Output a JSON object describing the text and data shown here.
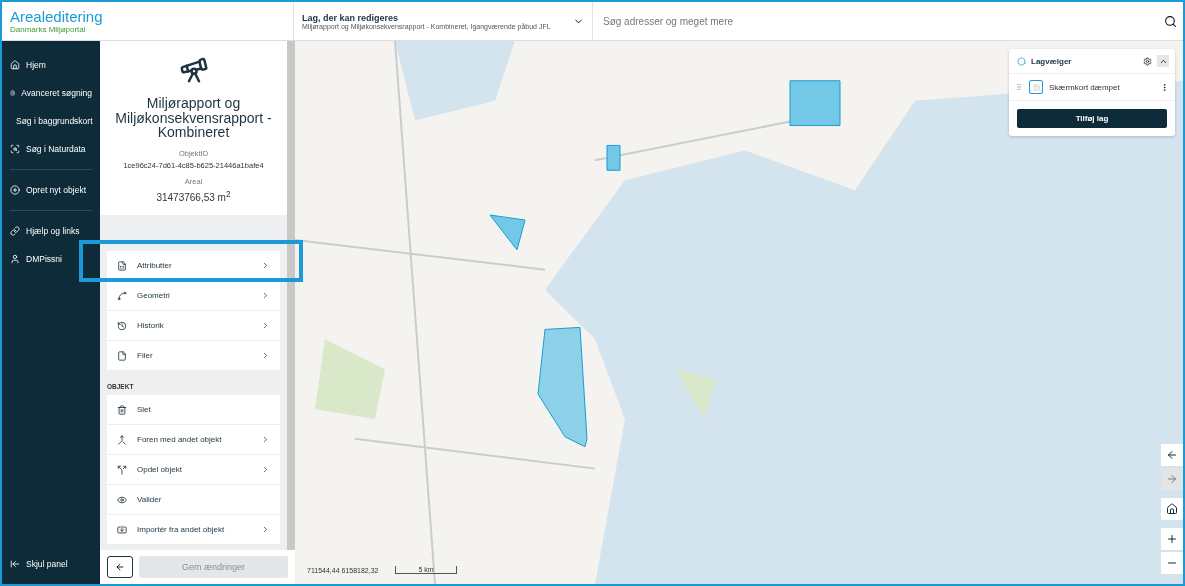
{
  "header": {
    "app_title": "Arealeditering",
    "app_subtitle": "Danmarks Miljøportal",
    "layer_select": {
      "label": "Lag, der kan redigeres",
      "value": "Miljørapport og Miljøkonsekvensrapport - Kombineret, Igangværende påbud JFL"
    },
    "search": {
      "placeholder": "Søg adresser og meget mere"
    }
  },
  "nav": {
    "items": [
      {
        "kind": "home",
        "label": "Hjem"
      },
      {
        "kind": "advanced",
        "label": "Avanceret søgning"
      },
      {
        "kind": "basemap",
        "label": "Søg i baggrundskort"
      },
      {
        "kind": "nature",
        "label": "Søg i Naturdata"
      },
      {
        "kind": "divider"
      },
      {
        "kind": "create",
        "label": "Opret nyt objekt"
      },
      {
        "kind": "divider"
      },
      {
        "kind": "help",
        "label": "Hjælp og links"
      },
      {
        "kind": "user",
        "label": "DMPissni"
      }
    ],
    "collapse": "Skjul panel"
  },
  "panel": {
    "title": "Miljørapport og Miljøkonsekvensrapport - Kombineret",
    "id_label": "ObjektID",
    "id_value": "1ce96c24-7d61-4c85-b625-21446a1bafe4",
    "area_label": "Areal",
    "area_value": "31473766,53 m$^{2}$",
    "menu": [
      {
        "kind": "attributes",
        "label": "Attributter",
        "arrow": true,
        "highlighted": true
      },
      {
        "kind": "geometry",
        "label": "Geometri",
        "arrow": true,
        "highlighted": false
      },
      {
        "kind": "history",
        "label": "Historik",
        "arrow": true,
        "highlighted": false
      },
      {
        "kind": "files",
        "label": "Filer",
        "arrow": true,
        "highlighted": false
      }
    ],
    "section": "OBJEKT",
    "actions": [
      {
        "kind": "delete",
        "label": "Slet",
        "arrow": false
      },
      {
        "kind": "merge",
        "label": "Foren med andet objekt",
        "arrow": true
      },
      {
        "kind": "split",
        "label": "Opdel objekt",
        "arrow": true
      },
      {
        "kind": "validate",
        "label": "Valider",
        "arrow": false
      },
      {
        "kind": "import",
        "label": "Importér fra andet objekt",
        "arrow": true
      }
    ],
    "save": {
      "label": "Gem ændringer",
      "disabled": true
    }
  },
  "map": {
    "coordinates": "711544,44 6158182,32",
    "scale": "5 km"
  },
  "layers": {
    "title": "Lagvælger",
    "items": [
      {
        "label": "Skærmkort dæmpet"
      }
    ],
    "add": "Tilføj lag"
  }
}
